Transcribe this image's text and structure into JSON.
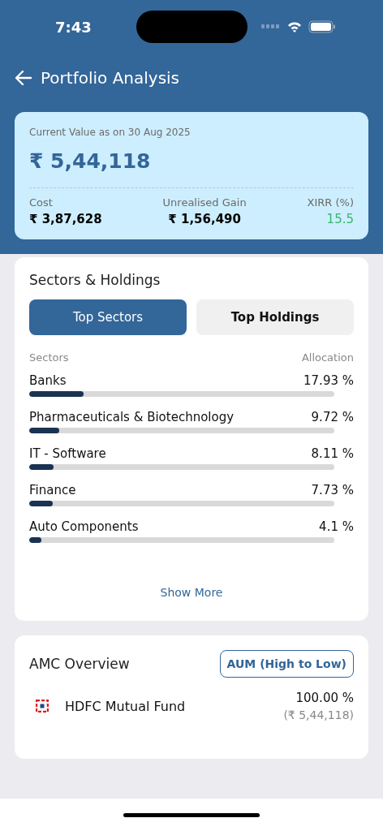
{
  "status_bar": {
    "time": "7:43"
  },
  "header": {
    "title": "Portfolio Analysis"
  },
  "summary": {
    "caption": "Current Value as on 30 Aug 2025",
    "value": "₹ 5,44,118",
    "stats": [
      {
        "label": "Cost",
        "value": "₹ 3,87,628",
        "kind": "plain"
      },
      {
        "label": "Unrealised Gain",
        "value": "₹ 1,56,490",
        "kind": "plain"
      },
      {
        "label": "XIRR (%)",
        "value": "15.5",
        "kind": "positive"
      }
    ]
  },
  "sectors": {
    "title": "Sectors & Holdings",
    "tabs": [
      {
        "label": "Top Sectors",
        "selected": true
      },
      {
        "label": "Top Holdings",
        "selected": false
      }
    ],
    "columns": [
      "Sectors",
      "Allocation"
    ],
    "rows": [
      {
        "name": "Banks",
        "allocation": "17.93 %",
        "level": 0.1793
      },
      {
        "name": "Pharmaceuticals & Biotechnology",
        "allocation": "9.72 %",
        "level": 0.0972
      },
      {
        "name": "IT - Software",
        "allocation": "8.11 %",
        "level": 0.0811
      },
      {
        "name": "Finance",
        "allocation": "7.73 %",
        "level": 0.0773
      },
      {
        "name": "Auto Components",
        "allocation": "4.1 %",
        "level": 0.041
      }
    ],
    "show_more": "Show More"
  },
  "amc": {
    "title": "AMC Overview",
    "sort": "AUM (High to Low)",
    "items": [
      {
        "name": "HDFC Mutual Fund",
        "percent": "100.00 %",
        "amount": "(₹ 5,44,118)"
      }
    ]
  }
}
